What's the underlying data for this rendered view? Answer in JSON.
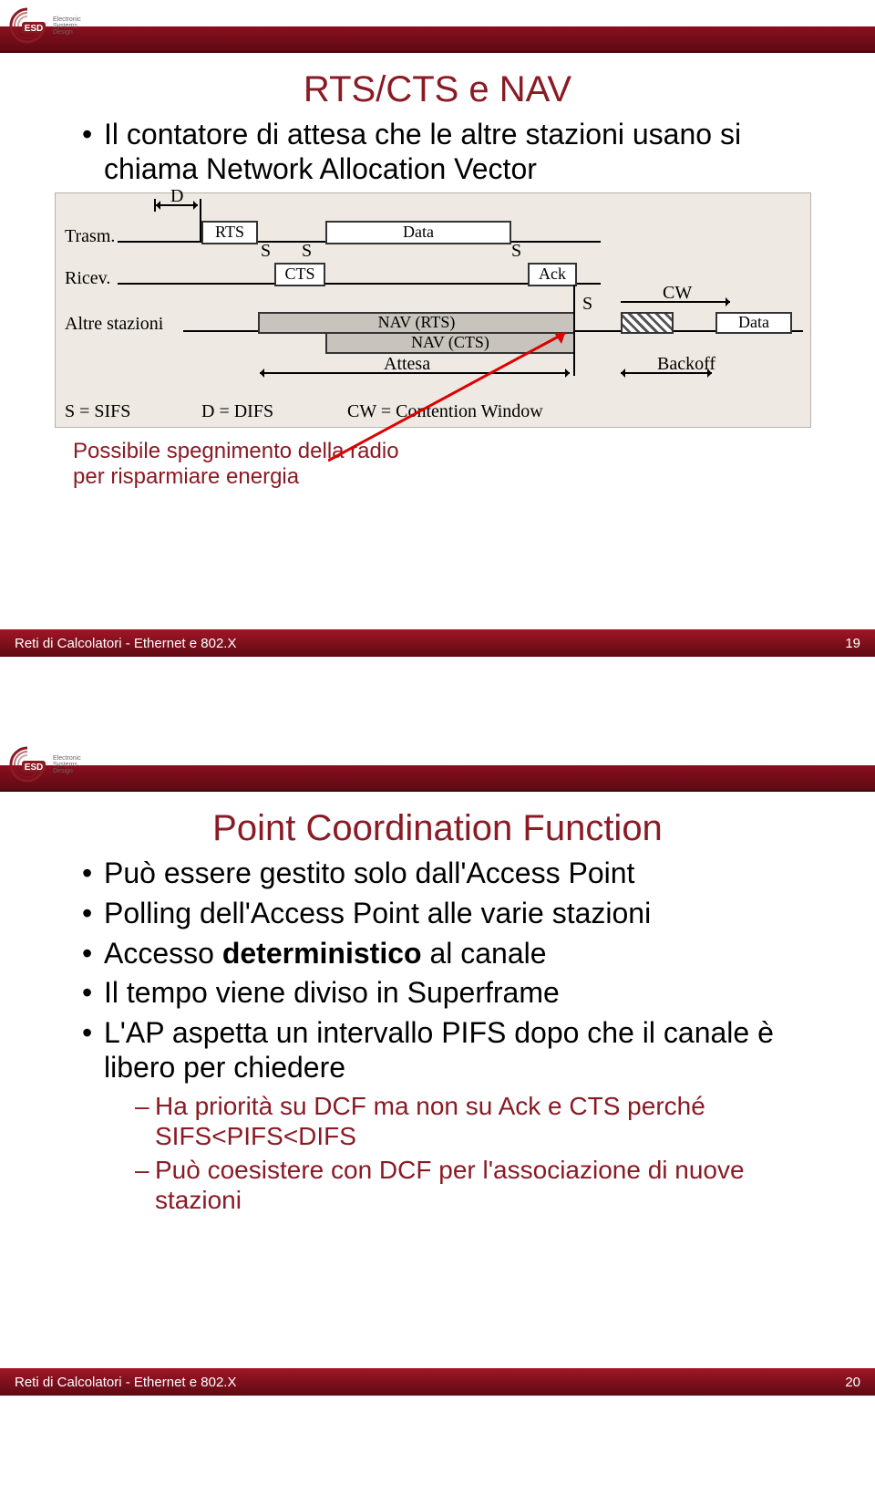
{
  "brand": {
    "main": "ESD",
    "sub1": "Electronic",
    "sub2": "Systems",
    "sub3": "Design"
  },
  "footer": {
    "left": "Reti di Calcolatori - Ethernet e 802.X",
    "page1": "19",
    "page2": "20"
  },
  "slide1": {
    "title": "RTS/CTS e NAV",
    "bullet1": "Il contatore di attesa che le altre stazioni usano si chiama Network Allocation Vector",
    "caption1": "Possibile spegnimento della radio",
    "caption2": "per risparmiare energia",
    "diag": {
      "trasm": "Trasm.",
      "ricev": "Ricev.",
      "altre": "Altre stazioni",
      "rts": "RTS",
      "cts": "CTS",
      "data": "Data",
      "ack": "Ack",
      "navrts": "NAV (RTS)",
      "navcts": "NAV (CTS)",
      "attesa": "Attesa",
      "s": "S",
      "d": "D",
      "cw": "CW",
      "data2": "Data",
      "backoff": "Backoff",
      "legend_s": "S = SIFS",
      "legend_d": "D = DIFS",
      "legend_cw": "CW = Contention Window"
    }
  },
  "slide2": {
    "title": "Point Coordination Function",
    "b1": "Può essere gestito solo dall'Access Point",
    "b2": "Polling dell'Access Point alle varie stazioni",
    "b3_pre": "Accesso ",
    "b3_strong": "deterministico",
    "b3_post": " al canale",
    "b4": "Il tempo viene diviso in Superframe",
    "b5": "L'AP aspetta un intervallo PIFS dopo che il canale è libero per chiedere",
    "s1": "Ha priorità su DCF ma non su Ack e CTS perché SIFS<PIFS<DIFS",
    "s2": "Può coesistere con DCF per l'associazione di nuove stazioni"
  }
}
